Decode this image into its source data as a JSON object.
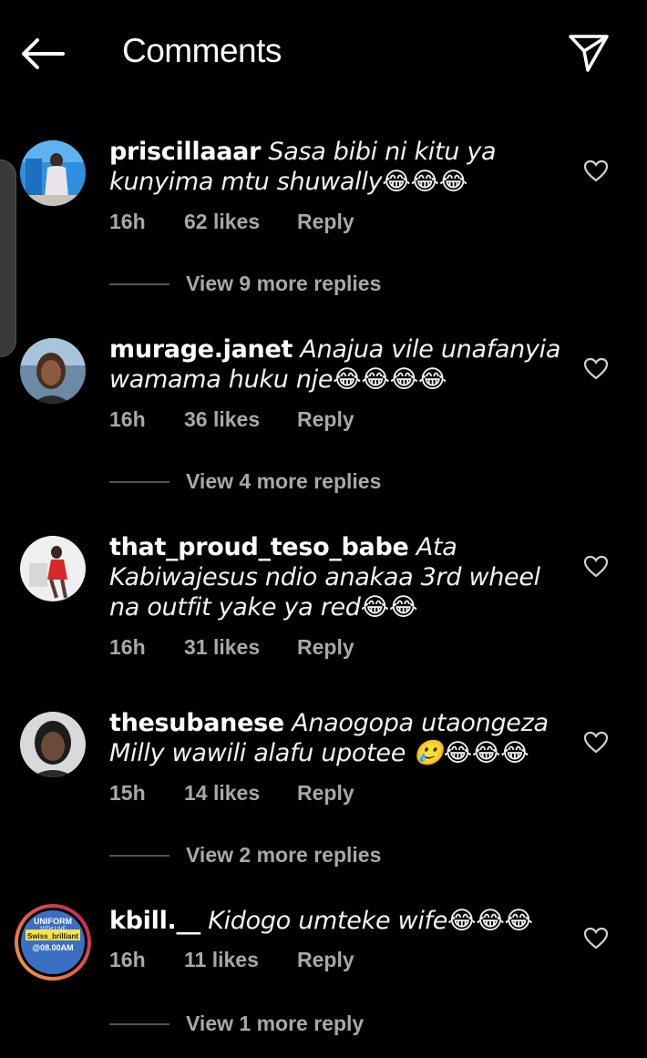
{
  "header": {
    "title": "Comments",
    "back_icon": "arrow-left-icon",
    "share_icon": "paper-plane-icon"
  },
  "comments": [
    {
      "username": "priscillaaar",
      "text": "Sasa bibi ni kitu ya kunyima mtu shuwally😂😂😂",
      "time": "16h",
      "likes": "62 likes",
      "reply": "Reply",
      "view_replies": "View 9 more replies"
    },
    {
      "username": "murage.janet",
      "text": "Anajua vile unafanyia wamama huku nje😂😂😂😂",
      "time": "16h",
      "likes": "36 likes",
      "reply": "Reply",
      "view_replies": "View 4 more replies"
    },
    {
      "username": "that_proud_teso_babe",
      "text": "Ata Kabiwajesus ndio anakaa 3rd wheel na outfit yake ya red😂😂",
      "time": "16h",
      "likes": "31 likes",
      "reply": "Reply",
      "view_replies": ""
    },
    {
      "username": "thesubanese",
      "text": "Anaogopa utaongeza Milly wawili alafu upotee 🥲😂😂😂",
      "time": "15h",
      "likes": "14 likes",
      "reply": "Reply",
      "view_replies": "View 2 more replies"
    },
    {
      "username": "kbill.__",
      "text": "Kidogo umteke wife😂😂😂",
      "time": "16h",
      "likes": "11 likes",
      "reply": "Reply",
      "view_replies": "View 1 more reply",
      "avatar_text": [
        "UNIFORM",
        "10TH LIVE",
        "Swiss_brilliant",
        "@08.00AM"
      ]
    }
  ],
  "colors": {
    "background": "#000000",
    "text": "#ffffff",
    "meta": "#a8a8a8",
    "story_ring_start": "#f9a23b",
    "story_ring_end": "#c2185b"
  }
}
